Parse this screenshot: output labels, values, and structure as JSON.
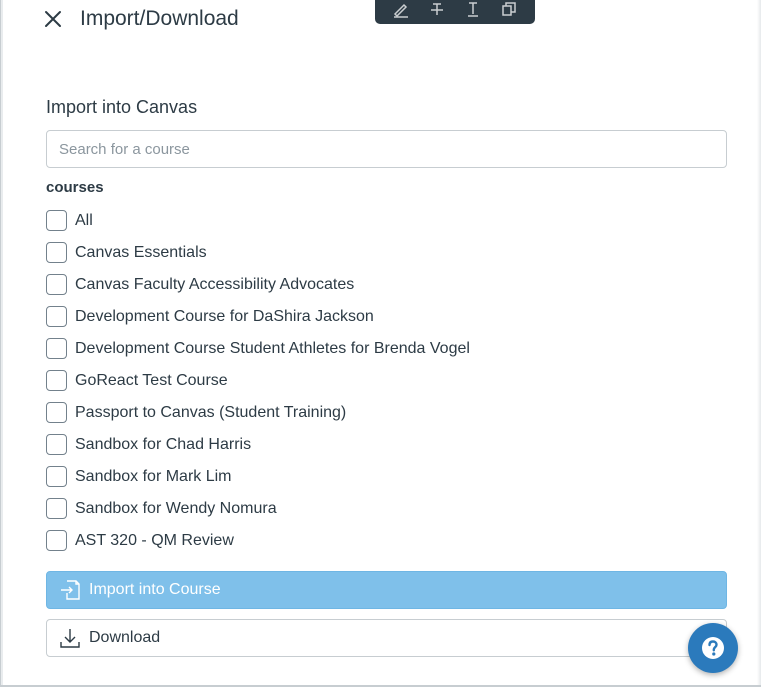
{
  "header": {
    "close_icon": "close-icon",
    "title": "Import/Download"
  },
  "toolbar": {
    "icons": [
      "highlight-pen-icon",
      "strikethrough-icon",
      "text-cursor-icon",
      "copy-icon"
    ]
  },
  "import_section": {
    "title": "Import into Canvas",
    "search_placeholder": "Search for a course",
    "search_value": "",
    "group_label": "courses",
    "courses": [
      {
        "label": "All",
        "checked": false
      },
      {
        "label": "Canvas Essentials",
        "checked": false
      },
      {
        "label": "Canvas Faculty Accessibility Advocates",
        "checked": false
      },
      {
        "label": "Development Course for DaShira Jackson",
        "checked": false
      },
      {
        "label": "Development Course Student Athletes for Brenda Vogel",
        "checked": false
      },
      {
        "label": "GoReact Test Course",
        "checked": false
      },
      {
        "label": "Passport to Canvas (Student Training)",
        "checked": false
      },
      {
        "label": "Sandbox for Chad Harris",
        "checked": false
      },
      {
        "label": "Sandbox for Mark Lim",
        "checked": false
      },
      {
        "label": "Sandbox for Wendy Nomura",
        "checked": false
      },
      {
        "label": "AST 320 - QM Review",
        "checked": false
      }
    ]
  },
  "actions": {
    "import_label": "Import into Course",
    "import_icon": "import-icon",
    "download_label": "Download",
    "download_icon": "download-icon"
  },
  "help": {
    "icon": "help-question-icon"
  },
  "colors": {
    "text": "#2d3b45",
    "import_button_bg": "#7fc0ea",
    "help_button_bg": "#2b7abc",
    "toolbar_bg": "#2d3b45"
  }
}
